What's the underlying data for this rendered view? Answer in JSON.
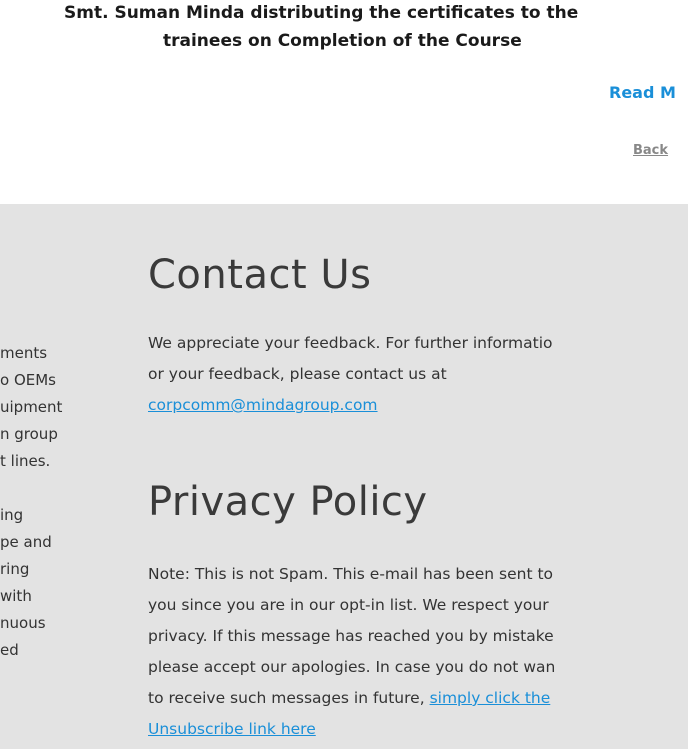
{
  "article": {
    "caption_line1": "Smt. Suman Minda distributing the certificates to the",
    "caption_line2": "trainees on Completion of the Course",
    "read_more": "Read M",
    "back_to_top": "Back "
  },
  "about": {
    "lines": [
      "ments",
      "o OEMs",
      "uipment",
      "n group",
      "t lines.",
      "",
      "ing",
      "pe and",
      "ring",
      "with",
      "nuous",
      "ed"
    ]
  },
  "contact": {
    "heading": "Contact Us",
    "line1": "We appreciate your feedback. For further informatio",
    "line2": "or your feedback, please contact us at",
    "email": "corpcomm@mindagroup.com"
  },
  "privacy": {
    "heading": "Privacy Policy",
    "line1": "Note: This is not Spam. This e-mail has been sent to",
    "line2": "you since you are in our opt-in list. We respect your",
    "line3": "privacy. If this message has reached you by mistake",
    "line4": "please accept our apologies. In case you do not wan",
    "line5_text": "to receive such messages in future, ",
    "line5_link": "simply click the",
    "line6_link": "Unsubscribe link here"
  },
  "colors": {
    "link": "#1a8fd8",
    "footer_bg": "#e3e3e3"
  }
}
